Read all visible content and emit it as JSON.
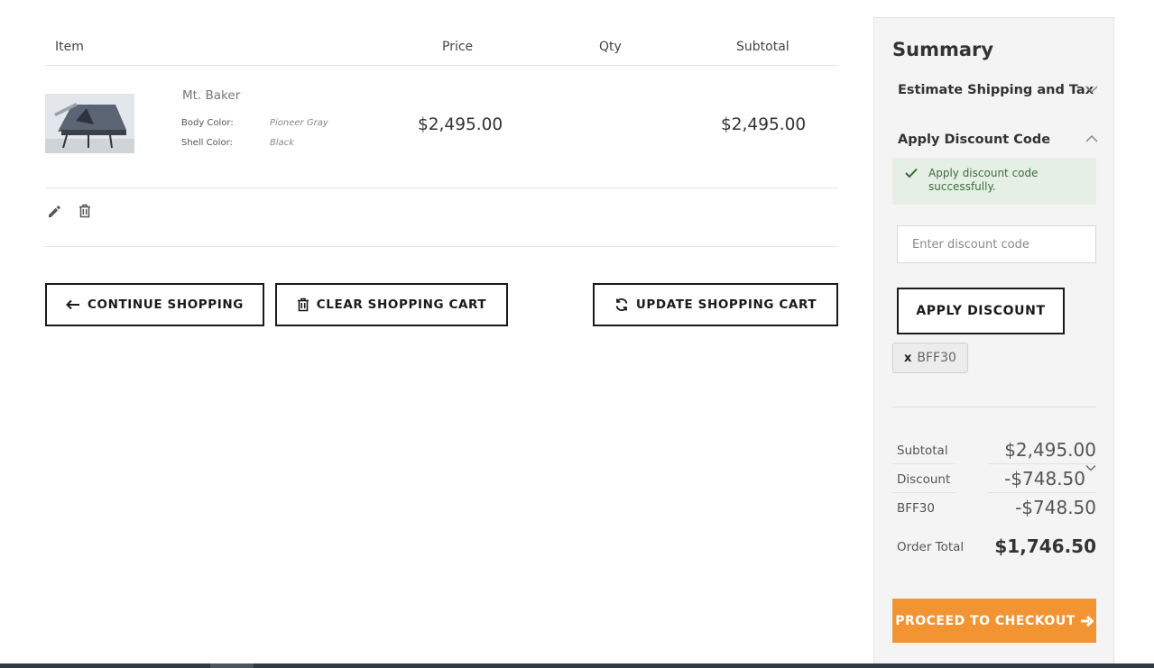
{
  "cart": {
    "headers": {
      "item": "Item",
      "price": "Price",
      "qty": "Qty",
      "subtotal": "Subtotal"
    },
    "items": [
      {
        "name": "Mt. Baker",
        "options": [
          {
            "label": "Body Color:",
            "value": "Pioneer Gray"
          },
          {
            "label": "Shell Color:",
            "value": "Black"
          }
        ],
        "price": "$2,495.00",
        "subtotal": "$2,495.00",
        "image": "tent-product-image"
      }
    ],
    "actions": {
      "edit_icon": "pencil-icon",
      "delete_icon": "trash-icon"
    }
  },
  "buttons": {
    "continue": "CONTINUE SHOPPING",
    "clear": "CLEAR SHOPPING CART",
    "update": "UPDATE SHOPPING CART"
  },
  "summary": {
    "title": "Summary",
    "estimate_shipping": "Estimate Shipping and Tax",
    "apply_discount_heading": "Apply Discount Code",
    "success_message": "Apply discount code successfully.",
    "discount_input_placeholder": "Enter discount code",
    "discount_input_value": "",
    "apply_button": "APPLY DISCOUNT",
    "applied_code_remove": "x",
    "applied_code": "BFF30",
    "totals": {
      "subtotal_label": "Subtotal",
      "subtotal_value": "$2,495.00",
      "discount_label": "Discount",
      "discount_value": "-$748.50",
      "code_label": "BFF30",
      "code_value": "-$748.50",
      "order_total_label": "Order Total",
      "order_total_value": "$1,746.50"
    },
    "checkout_button": "PROCEED TO CHECKOUT"
  },
  "colors": {
    "accent_orange": "#f39432",
    "success_bg": "#e5efe5",
    "success_text": "#3b6e3b",
    "sidebar_bg": "#f4f4f4",
    "button_border": "#1a1a1a"
  }
}
